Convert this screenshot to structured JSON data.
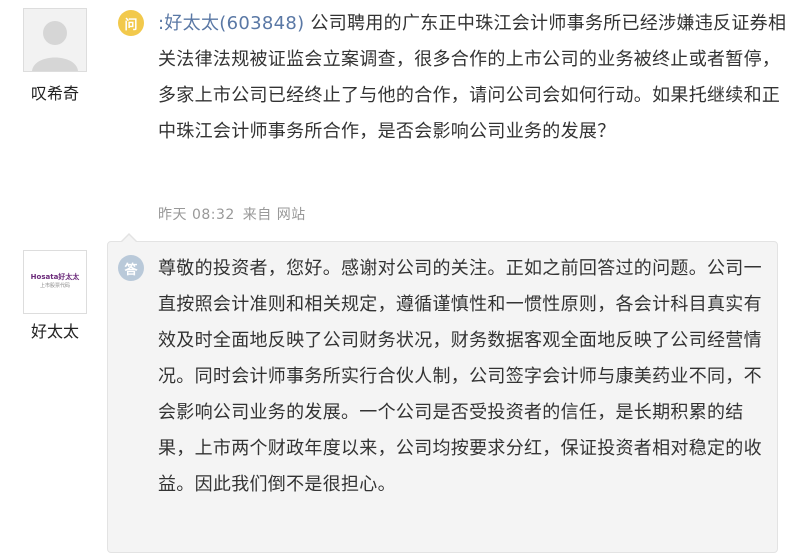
{
  "question": {
    "username": "叹希奇",
    "badge": "问",
    "asker": ":好太太(603848)",
    "text": "公司聘用的广东正中珠江会计师事务所已经涉嫌违反证券相关法律法规被证监会立案调查，很多合作的上市公司的业务被终止或者暂停，多家上市公司已经终止了与他的合作，请问公司会如何行动。如果托继续和正中珠江会计师事务所合作，是否会影响公司业务的发展？",
    "time": "昨天 08:32",
    "source": "来自 网站"
  },
  "answer": {
    "username": "好太太",
    "badge": "答",
    "logo_text": "Hosata好太太",
    "logo_sub": "上市股票代码",
    "text": "尊敬的投资者，您好。感谢对公司的关注。正如之前回答过的问题。公司一直按照会计准则和相关规定，遵循谨慎性和一惯性原则，各会计科目真实有效及时全面地反映了公司财务状况，财务数据客观全面地反映了公司经营情况。同时会计师事务所实行合伙人制，公司签字会计师与康美药业不同，不会影响公司业务的发展。一个公司是否受投资者的信任，是长期积累的结果，上市两个财政年度以来，公司均按要求分红，保证投资者相对稳定的收益。因此我们倒不是很担心。"
  },
  "colors": {
    "question_badge": "#f2c94c",
    "answer_badge": "#b9c9d9",
    "link": "#5a78a5",
    "meta": "#999999",
    "answer_bg": "#f4f4f4"
  }
}
